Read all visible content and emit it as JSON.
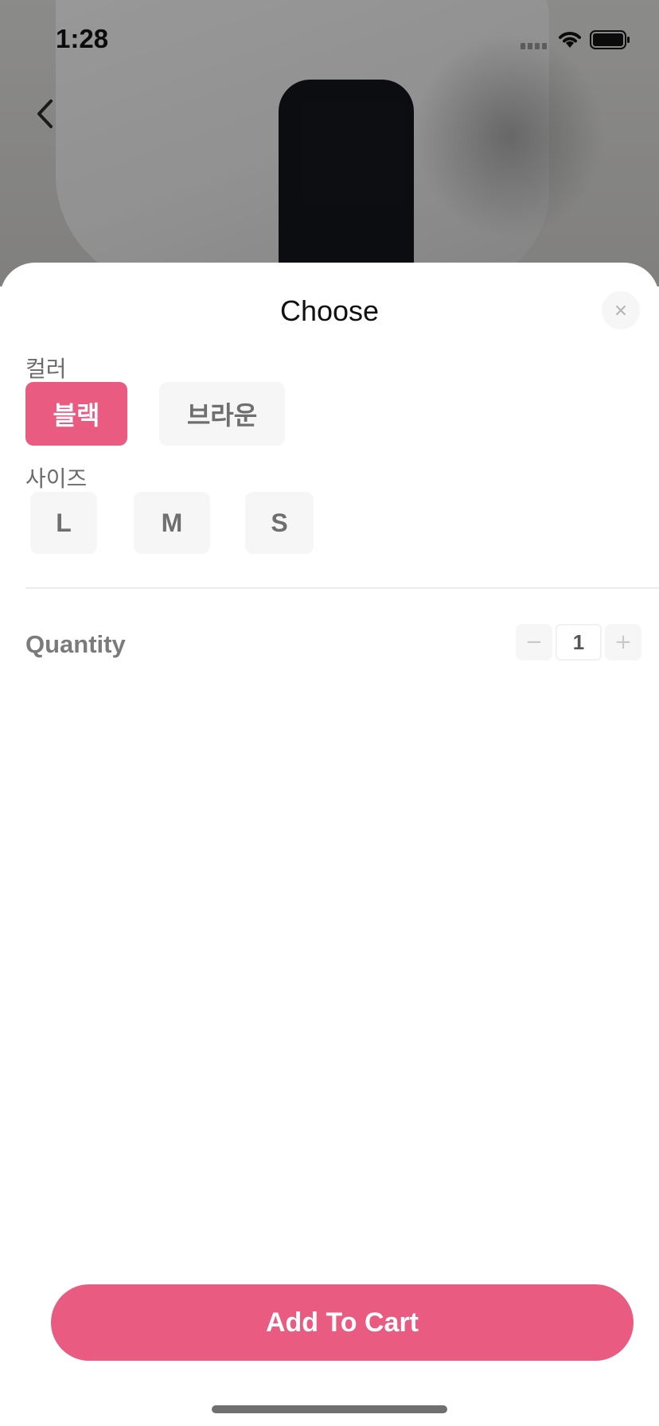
{
  "status_bar": {
    "time": "1:28"
  },
  "sheet": {
    "title": "Choose",
    "color_label": "컬러",
    "colors": [
      {
        "label": "블랙",
        "selected": true
      },
      {
        "label": "브라운",
        "selected": false
      }
    ],
    "size_label": "사이즈",
    "sizes": [
      {
        "label": "L",
        "selected": false
      },
      {
        "label": "M",
        "selected": false
      },
      {
        "label": "S",
        "selected": false
      }
    ],
    "quantity_label": "Quantity",
    "quantity_value": "1",
    "quantity_minus": "−",
    "quantity_plus": "+",
    "add_to_cart_label": "Add To Cart"
  },
  "colors": {
    "accent": "#e95b81",
    "option_bg": "#f6f6f6",
    "label_text": "#6b6b6b"
  },
  "icons": {
    "back": "chevron-left-icon",
    "close": "close-icon",
    "wifi": "wifi-icon",
    "battery": "battery-icon",
    "signal": "cellular-signal-icon"
  }
}
